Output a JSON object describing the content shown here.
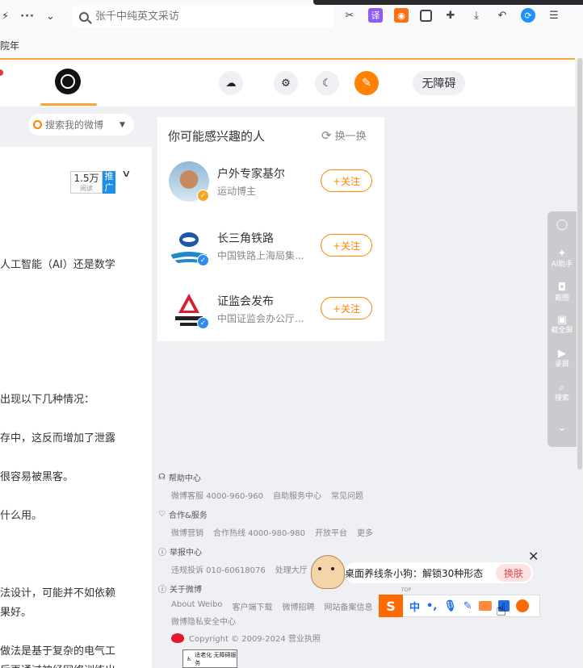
{
  "browser": {
    "search_placeholder": "张千中纯英文采访",
    "bookmark": "院年",
    "menu_dots": "···",
    "chevron": "⌄"
  },
  "nav": {
    "accessibility_label": "无障碍"
  },
  "my_search": {
    "placeholder": "搜索我的微博"
  },
  "feed": {
    "reads_count": "1.5万",
    "reads_label": "阅读",
    "promo_label": "推广",
    "lines": [
      "人工智能（AI）还是数学",
      "出现以下几种情况：",
      "存中，这反而增加了泄露",
      "很容易被黑客。",
      "什么用。",
      "法设计，可能并不如依赖",
      "果好。",
      "做法是基于复杂的电气工",
      "后再通过神经网络训练出"
    ]
  },
  "recommend": {
    "title": "你可能感兴趣的人",
    "refresh_label": "换一换",
    "people": [
      {
        "name": "户外专家基尔",
        "desc": "运动博主",
        "follow": "+关注"
      },
      {
        "name": "长三角铁路",
        "desc": "中国铁路上海局集...",
        "follow": "+关注"
      },
      {
        "name": "证监会发布",
        "desc": "中国证监会办公厅...",
        "follow": "+关注"
      }
    ]
  },
  "footer": {
    "sections": [
      {
        "title": "帮助中心",
        "links": [
          "微博客服 4000-960-960",
          "自助服务中心",
          "常见问题"
        ]
      },
      {
        "title": "合作&服务",
        "links": [
          "微博营销",
          "合作热线 4000-980-980",
          "开放平台",
          "更多"
        ]
      },
      {
        "title": "举报中心",
        "links": [
          "违规投诉 010-60618076",
          "处理大厅"
        ]
      },
      {
        "title": "关于微博",
        "links": [
          "About Weibo",
          "客户端下载",
          "微博招聘",
          "网站备案信息"
        ]
      }
    ],
    "extra_link": "微博隐私安全中心",
    "copyright": "Copyright © 2009-2024 营业执照",
    "access_badge": "适老化 无障碍服务"
  },
  "side_tools": [
    {
      "label": "AI助手"
    },
    {
      "label": "截图"
    },
    {
      "label": "截全屏"
    },
    {
      "label": "录屏"
    },
    {
      "label": "搜索"
    }
  ],
  "ime": {
    "popup_message": "桌面养线条小狗：解锁30种形态",
    "change_label": "换肤",
    "top_label": "TOP",
    "logo": "S",
    "zh_label": "中",
    "punct_label": "•,"
  }
}
